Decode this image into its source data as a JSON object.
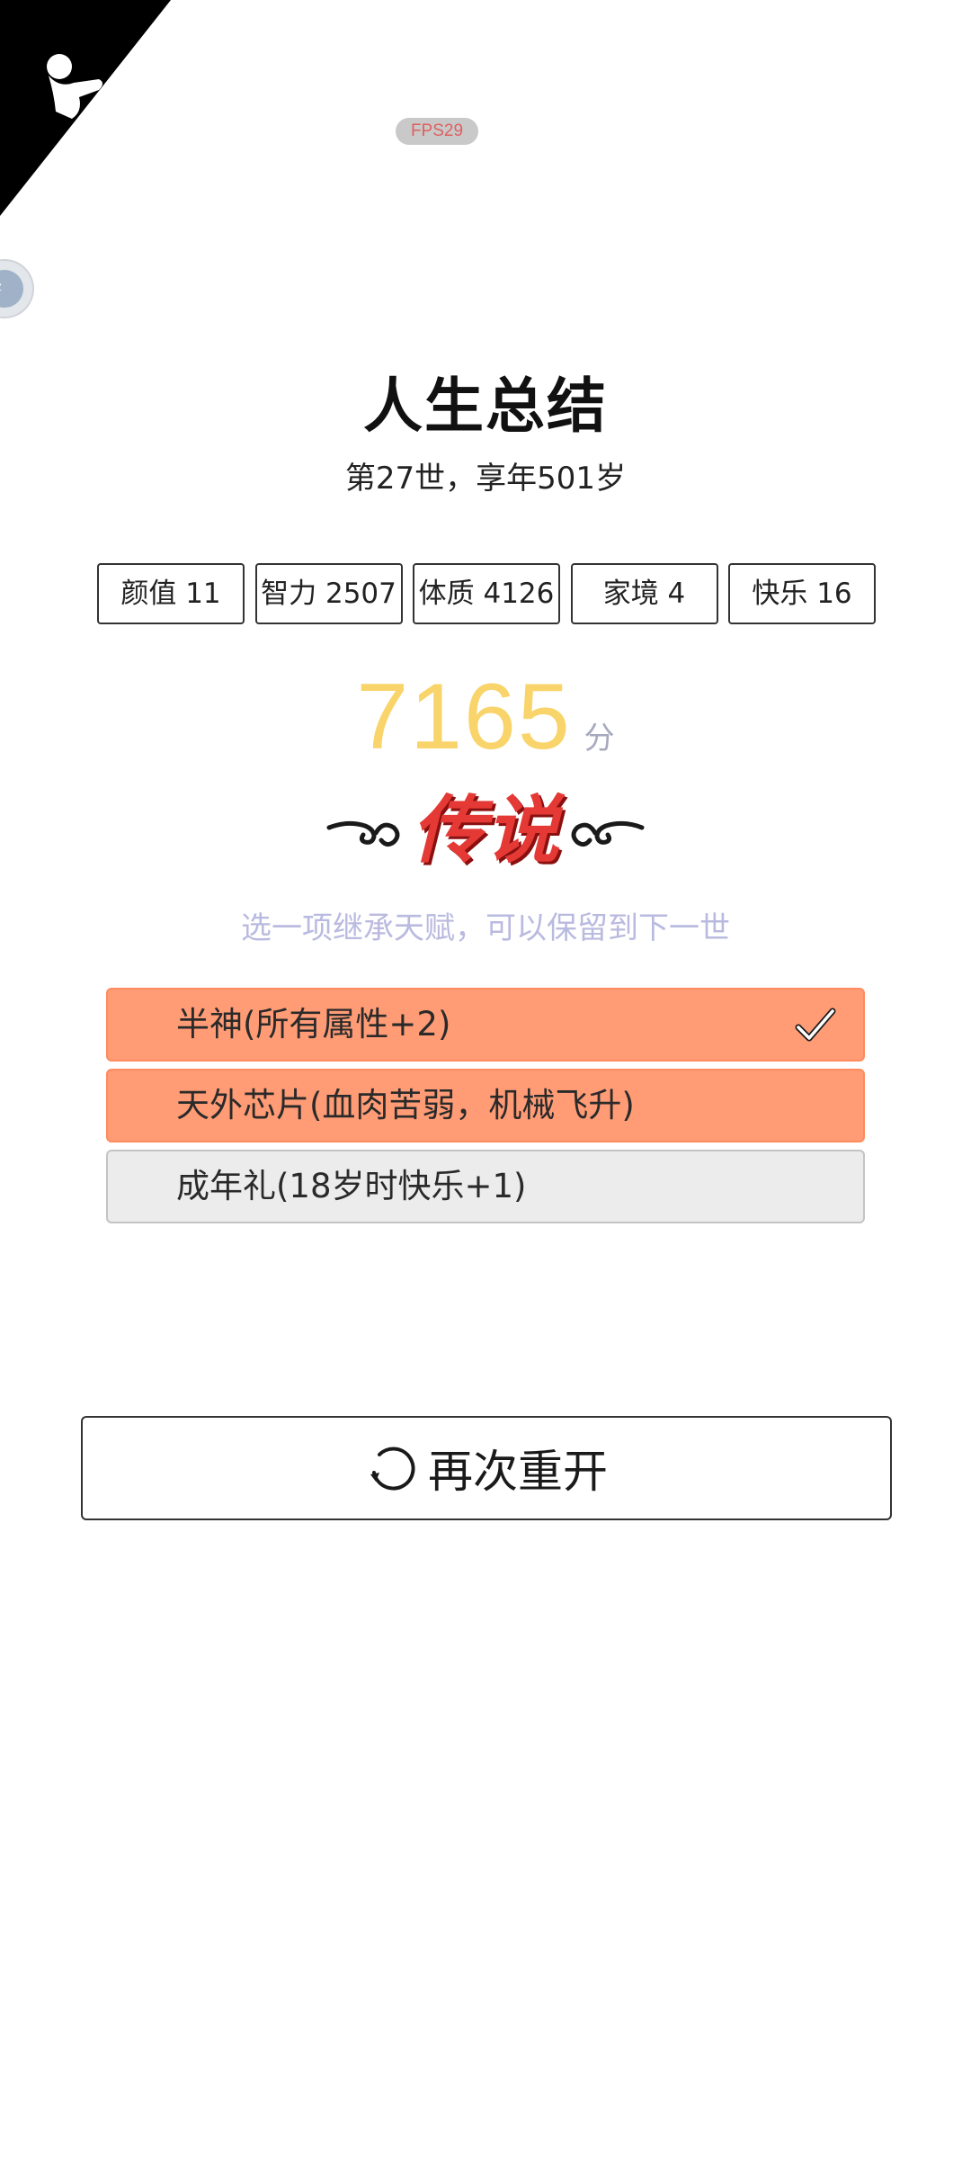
{
  "header": {
    "fps_label": "FPS29"
  },
  "summary": {
    "title": "人生总结",
    "subtitle": "第27世，享年501岁"
  },
  "stats": [
    {
      "label": "颜值 11"
    },
    {
      "label": "智力 2507"
    },
    {
      "label": "体质 4126"
    },
    {
      "label": "家境 4"
    },
    {
      "label": "快乐 16"
    }
  ],
  "score": {
    "value": "7165",
    "unit": "分",
    "grade": "传说",
    "score_color": "#f8d46a",
    "grade_color": "#e53935"
  },
  "inherit": {
    "hint": "选一项继承天赋，可以保留到下一世",
    "talents": [
      {
        "label": "半神(所有属性+2)",
        "selected": true
      },
      {
        "label": "天外芯片(血肉苦弱，机械飞升)",
        "selected": true
      },
      {
        "label": "成年礼(18岁时快乐+1)",
        "selected": false
      }
    ],
    "selected_color": "#ff9c76"
  },
  "actions": {
    "restart_label": "再次重开",
    "restart_icon": "refresh-icon"
  }
}
